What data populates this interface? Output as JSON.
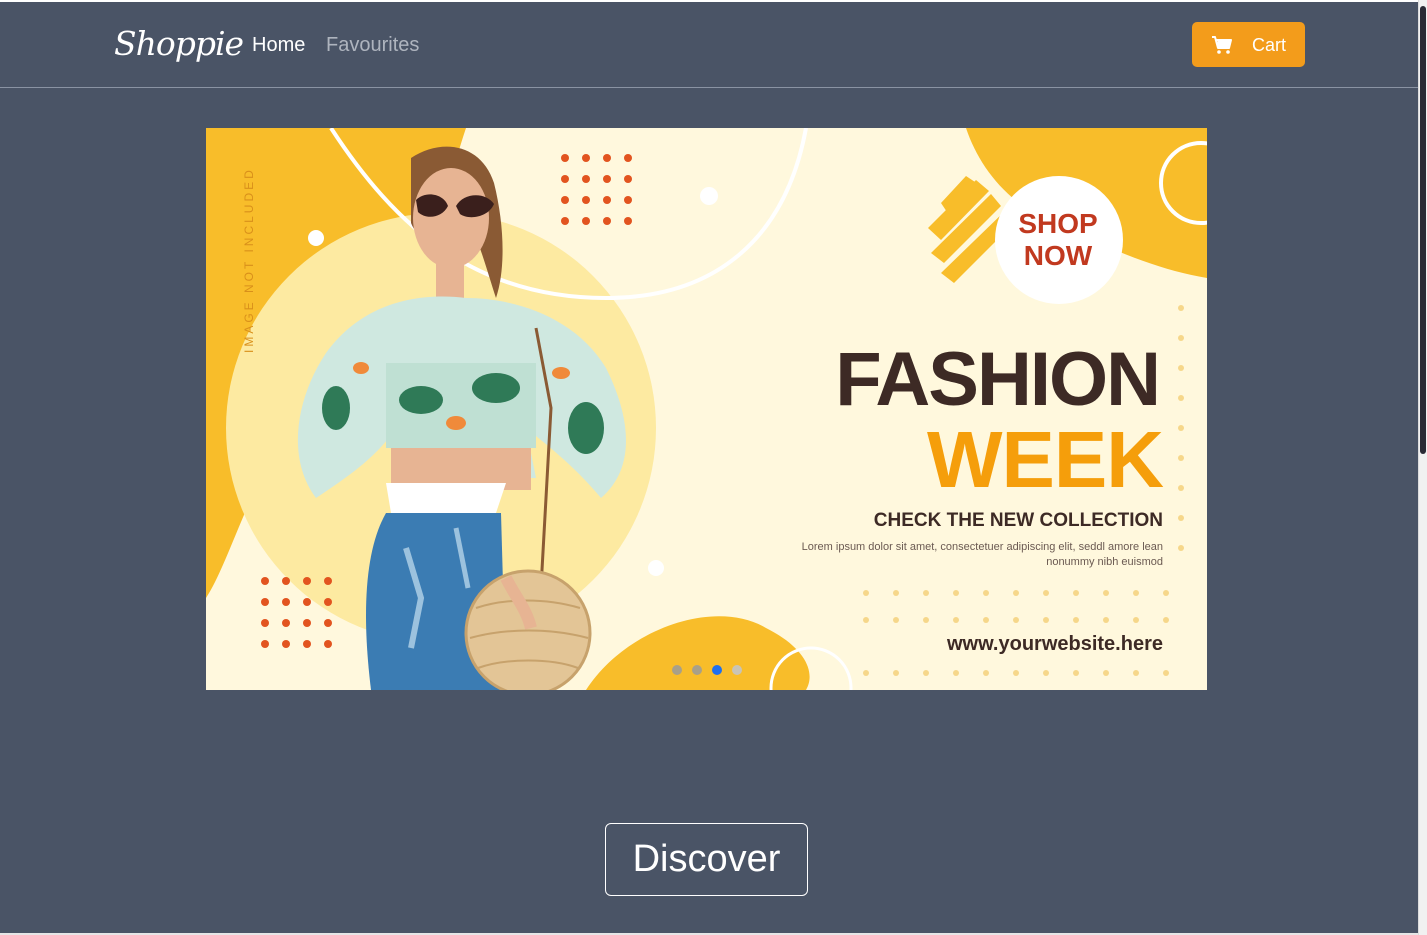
{
  "navbar": {
    "brand": "Shoppie",
    "links": [
      {
        "label": "Home",
        "active": true
      },
      {
        "label": "Favourites",
        "active": false
      }
    ],
    "cart_label": "Cart",
    "cart_icon": "cart-icon",
    "accent_color": "#f39c1b",
    "background_color": "#4a5466"
  },
  "carousel": {
    "banner": {
      "side_note": "IMAGE NOT INCLUDED",
      "badge_line1": "SHOP",
      "badge_line2": "NOW",
      "headline_1": "FASHION",
      "headline_2": "WEEK",
      "subheadline": "CHECK THE NEW COLLECTION",
      "body": "Lorem ipsum dolor sit amet, consectetuer adipiscing elit, seddl amore lean nonummy nibh euismod",
      "website": "www.yourwebsite.here"
    },
    "slide_count": 4,
    "active_slide": 3
  },
  "main": {
    "discover_label": "Discover"
  }
}
